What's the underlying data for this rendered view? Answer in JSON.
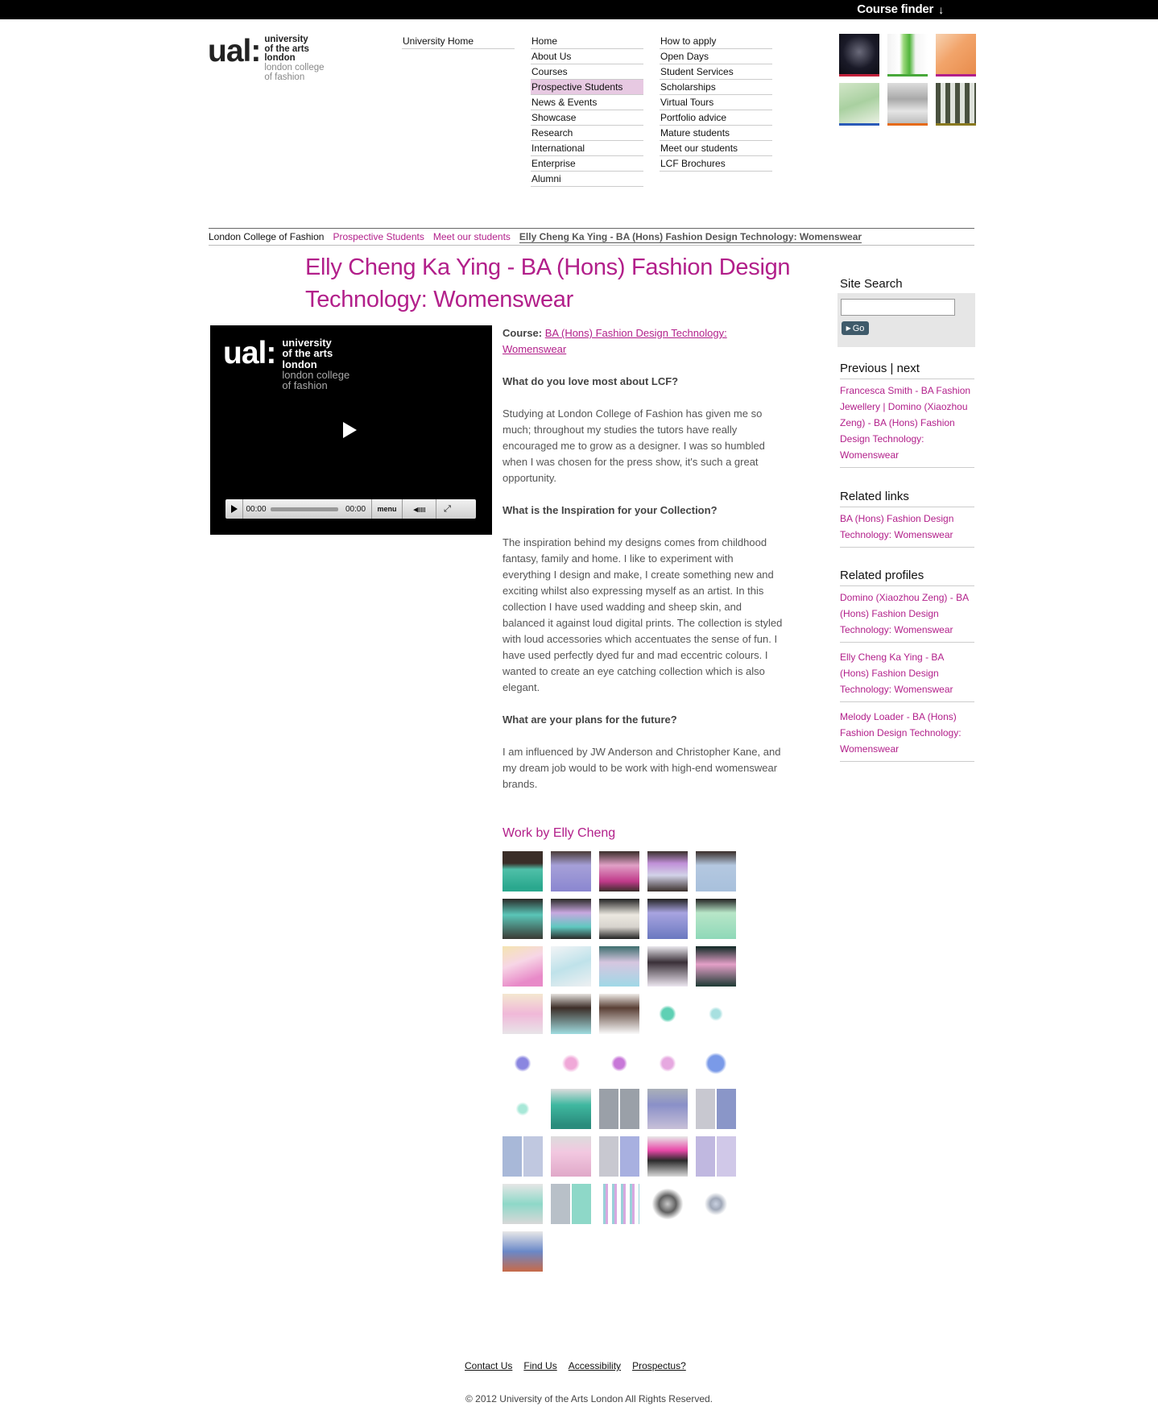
{
  "topbar": {
    "course_finder": "Course finder",
    "arrow_icon": "arrow-down-icon"
  },
  "header_logo": {
    "mark": "ual:",
    "line1": "university",
    "line2": "of the arts",
    "line3": "london",
    "line4": "london college",
    "line5": "of fashion"
  },
  "nav": {
    "col1": [
      "University Home"
    ],
    "col2": [
      "Home",
      "About Us",
      "Courses",
      "Prospective Students",
      "News & Events",
      "Showcase",
      "Research",
      "International",
      "Enterprise",
      "Alumni"
    ],
    "col3": [
      "How to apply",
      "Open Days",
      "Student Services",
      "Scholarships",
      "Virtual Tours",
      "Portfolio advice",
      "Mature students",
      "Meet our students",
      "LCF Brochures"
    ],
    "active": "Prospective Students"
  },
  "breadcrumb": {
    "c1": "London College of Fashion",
    "c2": "Prospective Students",
    "c3": "Meet our students",
    "current": "Elly Cheng Ka Ying - BA (Hons) Fashion Design Technology: Womenswear"
  },
  "page_title": "Elly Cheng Ka Ying - BA (Hons) Fashion Design Technology: Womenswear",
  "video": {
    "logo": {
      "mark": "ual:",
      "line1": "university",
      "line2": "of the arts",
      "line3": "london",
      "line4": "london college",
      "line5": "of fashion"
    },
    "time_current": "00:00",
    "time_total": "00:00",
    "menu_label": "menu"
  },
  "content": {
    "course_label": "Course:",
    "course_link": "BA (Hons) Fashion Design Technology: Womenswear",
    "q1": "What do you love most about LCF?",
    "a1": "Studying at London College of Fashion has given me so much; throughout my studies the tutors have really encouraged me to grow as a designer. I was so humbled when I was chosen for the press show, it's such a great opportunity.",
    "q2": "What is the Inspiration for your Collection?",
    "a2": "The inspiration behind my designs comes from childhood fantasy, family and home. I like to experiment with everything I design and make, I create something new and exciting whilst also expressing myself as an artist. In this collection I have used wadding and sheep skin, and balanced it against loud digital prints. The collection is styled with loud accessories which accentuates the sense of fun. I have used perfectly dyed fur and mad eccentric colours. I wanted to create an eye catching collection which is also elegant.",
    "q3": "What are your plans for the future?",
    "a3": "I am influenced by JW Anderson and Christopher Kane, and my dream job would to be work with high-end womenswear brands."
  },
  "work_title": "Work by Elly Cheng",
  "sidebar": {
    "search_title": "Site Search",
    "go_label": "Go",
    "prevnext_title": "Previous | next",
    "prevnext_link": "Francesca Smith - BA Fashion Jewellery | Domino (Xiaozhou Zeng) - BA (Hons) Fashion Design Technology: Womenswear",
    "related_links_title": "Related links",
    "related_links": [
      "BA (Hons) Fashion Design Technology: Womenswear"
    ],
    "related_profiles_title": "Related profiles",
    "related_profiles": [
      "Domino (Xiaozhou Zeng) - BA (Hons) Fashion Design Technology: Womenswear",
      "Elly Cheng Ka Ying - BA (Hons) Fashion Design Technology: Womenswear",
      "Melody Loader - BA (Hons) Fashion Design Technology: Womenswear"
    ]
  },
  "footer": {
    "links": [
      "Contact Us",
      "Find Us",
      "Accessibility",
      "Prospectus?"
    ],
    "copyright": "© 2012 University of the Arts London All Rights Reserved."
  }
}
